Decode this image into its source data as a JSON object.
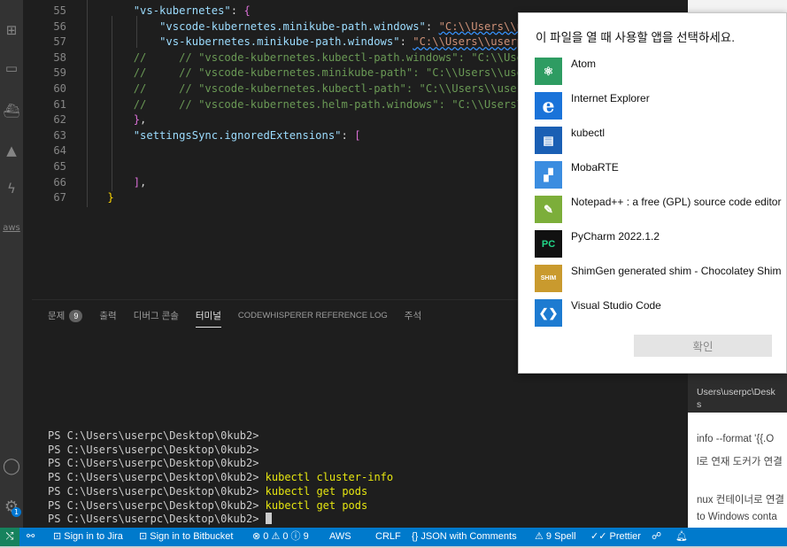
{
  "activity_bar": {
    "items": [
      {
        "name": "extensions-icon",
        "glyph": "⊞"
      },
      {
        "name": "remote-explorer-icon",
        "glyph": "▭"
      },
      {
        "name": "docker-icon",
        "glyph": "⛴"
      },
      {
        "name": "kubernetes-icon",
        "glyph": "▲"
      },
      {
        "name": "thunder-icon",
        "glyph": "ϟ"
      },
      {
        "name": "aws-icon",
        "glyph": "aws"
      }
    ],
    "account_icon": "◯",
    "manage_icon": "⚙",
    "manage_badge": "1"
  },
  "editor": {
    "lines": [
      {
        "num": "55",
        "html_parts": [
          [
            "key",
            "\"vs-kubernetes\""
          ],
          [
            "pun",
            ": "
          ],
          [
            "br2",
            "{"
          ]
        ]
      },
      {
        "num": "56",
        "html_parts": [
          [
            "key",
            "\"vscode-kubernetes.minikube-path.windows\""
          ],
          [
            "pun",
            ": "
          ],
          [
            "str",
            "\"C:\\\\Users\\\\userpc\\\\Desktop\\\\"
          ]
        ]
      },
      {
        "num": "57",
        "html_parts": [
          [
            "key",
            "\"vs-kubernetes.minikube-path.windows\""
          ],
          [
            "pun",
            ": "
          ],
          [
            "str",
            "\"C:\\\\Users\\\\userpc\\\\Desktop\\\\"
          ]
        ]
      },
      {
        "num": "58",
        "html_parts": [
          [
            "cmt",
            "//     // \"vscode-kubernetes.kubectl-path.windows\": \"C:\\\\Users\\\\userpc"
          ]
        ]
      },
      {
        "num": "59",
        "html_parts": [
          [
            "cmt",
            "//     // \"vscode-kubernetes.minikube-path\": \"C:\\\\Users\\\\userpc\\\\Desk"
          ]
        ]
      },
      {
        "num": "60",
        "html_parts": [
          [
            "cmt",
            "//     // \"vscode-kubernetes.kubectl-path\": \"C:\\\\Users\\\\userpc\\\\Deskt"
          ]
        ]
      },
      {
        "num": "61",
        "html_parts": [
          [
            "cmt",
            "//     // \"vscode-kubernetes.helm-path.windows\": \"C:\\\\Users\\\\userpc\\\\"
          ]
        ]
      },
      {
        "num": "62",
        "html_parts": [
          [
            "br2",
            "}"
          ],
          [
            "pun",
            ","
          ]
        ]
      },
      {
        "num": "63",
        "html_parts": [
          [
            "key",
            "\"settingsSync.ignoredExtensions\""
          ],
          [
            "pun",
            ": "
          ],
          [
            "br2",
            "["
          ]
        ]
      },
      {
        "num": "64",
        "html_parts": []
      },
      {
        "num": "65",
        "html_parts": []
      },
      {
        "num": "66",
        "html_parts": [
          [
            "br2",
            "]"
          ],
          [
            "pun",
            ","
          ]
        ]
      },
      {
        "num": "67",
        "html_parts": [
          [
            "br1",
            "}"
          ]
        ]
      }
    ]
  },
  "panel": {
    "tabs": [
      {
        "label": "문제",
        "badge": "9",
        "active": false
      },
      {
        "label": "출력",
        "active": false
      },
      {
        "label": "디버그 콘솔",
        "active": false
      },
      {
        "label": "터미널",
        "active": true
      },
      {
        "label": "CODEWHISPERER REFERENCE LOG",
        "active": false
      },
      {
        "label": "주석",
        "active": false
      }
    ],
    "terminal_lines": [
      {
        "prompt": "PS C:\\Users\\userpc\\Desktop\\0kub2> ",
        "cmd": ""
      },
      {
        "prompt": "PS C:\\Users\\userpc\\Desktop\\0kub2> ",
        "cmd": ""
      },
      {
        "prompt": "PS C:\\Users\\userpc\\Desktop\\0kub2> ",
        "cmd": ""
      },
      {
        "prompt": "PS C:\\Users\\userpc\\Desktop\\0kub2> ",
        "cmd": "kubectl cluster-info"
      },
      {
        "prompt": "PS C:\\Users\\userpc\\Desktop\\0kub2> ",
        "cmd": "kubectl get pods"
      },
      {
        "prompt": "PS C:\\Users\\userpc\\Desktop\\0kub2> ",
        "cmd": "kubectl get pods"
      },
      {
        "prompt": "PS C:\\Users\\userpc\\Desktop\\0kub2> ",
        "cmd": ""
      }
    ]
  },
  "background_window": {
    "lines": [
      "Users\\userpc\\Desk",
      "s",
      "info --format '{{.O",
      "l로 연재 도커가 연결",
      "nux 컨테이너로 연결",
      "to Windows conta"
    ]
  },
  "dialog": {
    "title": "이 파일을 열 때 사용할 앱을 선택하세요.",
    "apps": [
      {
        "name": "Atom",
        "icon": "atom-icon",
        "color": "#2e9c62",
        "glyph": "⚛"
      },
      {
        "name": "Internet Explorer",
        "icon": "internet-explorer-icon",
        "color": "#1a73d9",
        "glyph": "e"
      },
      {
        "name": "kubectl",
        "icon": "kubectl-icon",
        "color": "#1a5fb4",
        "glyph": "▤"
      },
      {
        "name": "MobaRTE",
        "icon": "mobarte-icon",
        "color": "#3b8de0",
        "glyph": "▞"
      },
      {
        "name": "Notepad++ : a free (GPL) source code editor",
        "icon": "notepad-plus-plus-icon",
        "color": "#7cae3a",
        "glyph": "✎"
      },
      {
        "name": "PyCharm 2022.1.2",
        "icon": "pycharm-icon",
        "color": "#0f9d58",
        "glyph": "PC"
      },
      {
        "name": "ShimGen generated shim - Chocolatey Shim",
        "icon": "shimgen-icon",
        "color": "#c99a2e",
        "glyph": "SHIM"
      },
      {
        "name": "Visual Studio Code",
        "icon": "vscode-icon",
        "color": "#1d7bd1",
        "glyph": "❮❯"
      }
    ],
    "ok_label": "확인"
  },
  "status_bar": {
    "items": [
      {
        "name": "live-share-item",
        "text": "⚯"
      },
      {
        "name": "jira-sign-in-item",
        "text": "⊡ Sign in to Jira"
      },
      {
        "name": "bitbucket-sign-in-item",
        "text": "⊡ Sign in to Bitbucket"
      },
      {
        "name": "problems-item",
        "text": "⊗ 0 ⚠ 0 ⓘ 9"
      },
      {
        "name": "aws-item",
        "text": "AWS"
      },
      {
        "name": "eol-item",
        "text": "CRLF"
      },
      {
        "name": "language-mode-item",
        "text": "{} JSON with Comments"
      },
      {
        "name": "spell-item",
        "text": "⚠ 9 Spell"
      },
      {
        "name": "prettier-item",
        "text": "✓✓ Prettier"
      },
      {
        "name": "feedback-item",
        "text": "☍"
      },
      {
        "name": "notifications-item",
        "text": "🔔︎"
      }
    ]
  }
}
